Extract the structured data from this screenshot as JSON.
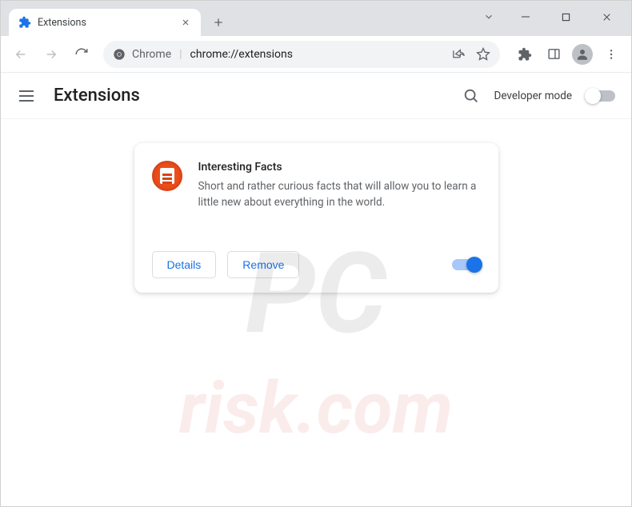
{
  "tab": {
    "title": "Extensions"
  },
  "omnibox": {
    "protocol_label": "Chrome",
    "url": "chrome://extensions"
  },
  "header": {
    "title": "Extensions",
    "developer_mode_label": "Developer mode",
    "developer_mode_on": false
  },
  "extension": {
    "name": "Interesting Facts",
    "description": "Short and rather curious facts that will allow you to learn a little new about everything in the world.",
    "details_label": "Details",
    "remove_label": "Remove",
    "enabled": true
  },
  "watermark": {
    "line1": "PC",
    "line2": "risk.com"
  }
}
